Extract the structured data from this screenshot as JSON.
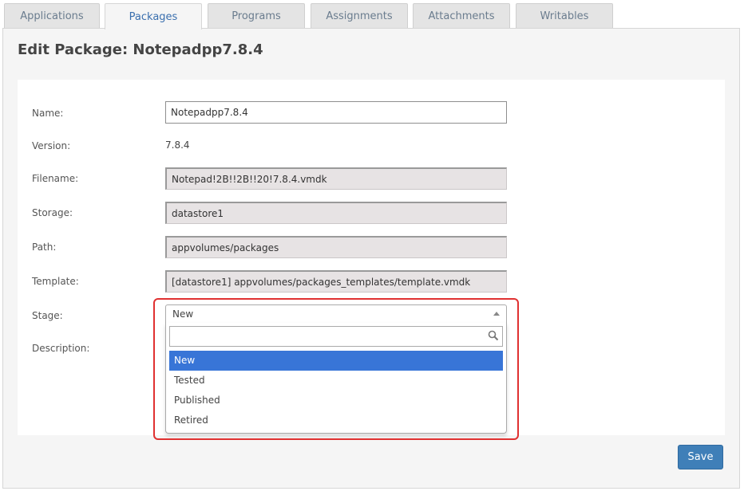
{
  "tabs": [
    {
      "label": "Applications",
      "active": false
    },
    {
      "label": "Packages",
      "active": true
    },
    {
      "label": "Programs",
      "active": false
    },
    {
      "label": "Assignments",
      "active": false
    },
    {
      "label": "Attachments",
      "active": false
    },
    {
      "label": "Writables",
      "active": false
    }
  ],
  "page": {
    "title": "Edit Package: Notepadpp7.8.4"
  },
  "form": {
    "name": {
      "label": "Name:",
      "value": "Notepadpp7.8.4"
    },
    "version": {
      "label": "Version:",
      "value": "7.8.4"
    },
    "filename": {
      "label": "Filename:",
      "value": "Notepad!2B!!2B!!20!7.8.4.vmdk"
    },
    "storage": {
      "label": "Storage:",
      "value": "datastore1"
    },
    "path": {
      "label": "Path:",
      "value": "appvolumes/packages"
    },
    "template": {
      "label": "Template:",
      "value": "[datastore1] appvolumes/packages_templates/template.vmdk"
    },
    "stage": {
      "label": "Stage:",
      "selected": "New",
      "search_value": "",
      "options": [
        "New",
        "Tested",
        "Published",
        "Retired"
      ]
    },
    "description": {
      "label": "Description:"
    }
  },
  "actions": {
    "save_label": "Save"
  },
  "colors": {
    "accent": "#3875d7",
    "save_button": "#3f7fb8",
    "highlight": "#e03131",
    "active_tab_text": "#3a6fae"
  },
  "icons": {
    "search": "search-icon",
    "dropdown_arrow": "chevron-up-icon"
  }
}
